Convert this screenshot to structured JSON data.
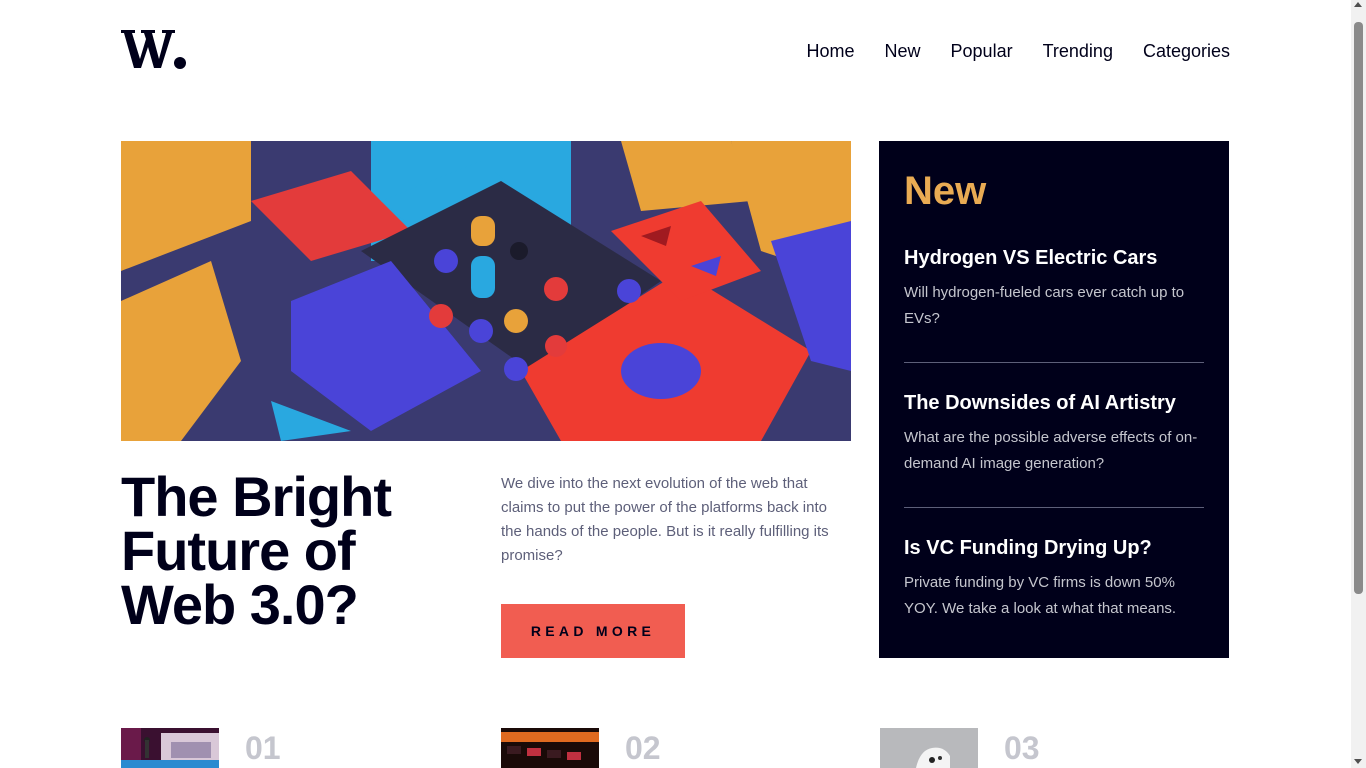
{
  "header": {
    "logo_text": "W.",
    "nav": [
      {
        "label": "Home"
      },
      {
        "label": "New"
      },
      {
        "label": "Popular"
      },
      {
        "label": "Trending"
      },
      {
        "label": "Categories"
      }
    ]
  },
  "hero": {
    "image": "abstract-3d-blocks-illustration",
    "title": "The Bright Future of Web 3.0?",
    "description": "We dive into the next evolution of the web that claims to put the power of the platforms back into the hands of the people. But is it really fulfilling its promise?",
    "button_label": "READ MORE"
  },
  "new_panel": {
    "title": "New",
    "items": [
      {
        "title": "Hydrogen VS Electric Cars",
        "text": "Will hydrogen-fueled cars ever catch up to EVs?"
      },
      {
        "title": "The Downsides of AI Artistry",
        "text": "What are the possible adverse effects of on-demand AI image generation?"
      },
      {
        "title": "Is VC Funding Drying Up?",
        "text": "Private funding by VC firms is down 50% YOY. We take a look at what that means."
      }
    ]
  },
  "bottom_items": [
    {
      "number": "01",
      "image": "retro-pcs-thumbnail"
    },
    {
      "number": "02",
      "image": "gaming-keyboard-thumbnail"
    },
    {
      "number": "03",
      "image": "gaming-controller-thumbnail"
    }
  ],
  "colors": {
    "accent": "#f15d51",
    "highlight": "#e9ab53",
    "dark": "#00001a",
    "muted": "#5d5f79"
  }
}
